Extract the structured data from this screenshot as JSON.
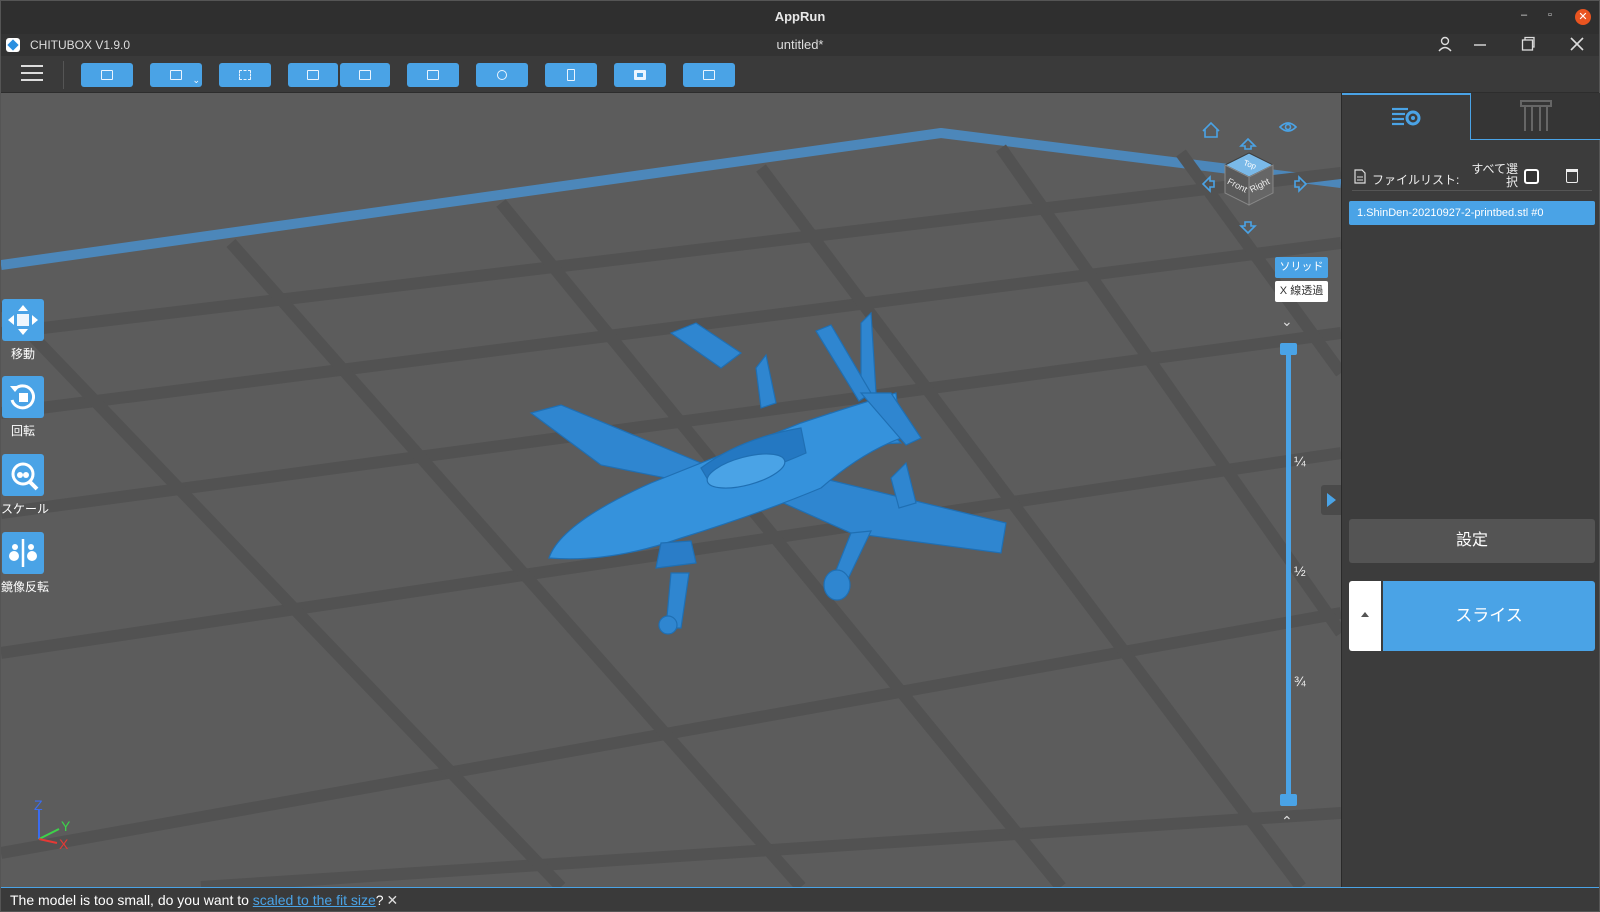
{
  "os_titlebar": {
    "title": "AppRun",
    "minimize": "–",
    "restore": "▫",
    "close": "✕"
  },
  "app_titlebar": {
    "app_name": "CHITUBOX V1.9.0",
    "document": "untitled*"
  },
  "toolbar": {
    "buttons": [
      "open-file",
      "save",
      "select-region",
      "undo",
      "redo",
      "copy",
      "arrange",
      "support",
      "hollow",
      "add-box"
    ]
  },
  "left_tools": [
    {
      "label": "移動",
      "icon": "move-icon"
    },
    {
      "label": "回転",
      "icon": "rotate-icon"
    },
    {
      "label": "スケール",
      "icon": "scale-icon"
    },
    {
      "label": "鏡像反転",
      "icon": "mirror-icon"
    }
  ],
  "view_cube": {
    "top": "Top",
    "front": "Front",
    "right": "Right"
  },
  "view_modes": {
    "solid": "ソリッド",
    "xray": "X 線透過"
  },
  "layer_slider": {
    "marks": [
      "¼",
      "½",
      "¾"
    ],
    "up": "⌃",
    "down": "⌄"
  },
  "axis_gizmo": {
    "z": "Z",
    "y": "Y",
    "x": "X",
    "z_color": "#3b6cf0",
    "y_color": "#3dd34a",
    "x_color": "#e53935"
  },
  "right_panel": {
    "file_list_label": "ファイルリスト:",
    "select_all_label": "すべて選択",
    "files": [
      "1.ShinDen-20210927-2-printbed.stl #0"
    ],
    "settings_label": "設定",
    "slice_label": "スライス"
  },
  "notification": {
    "prefix": "The model is too small, do you want to ",
    "link": "scaled to the fit size",
    "suffix": "?",
    "close": "✕"
  },
  "colors": {
    "accent": "#4aa3e6",
    "grid_bg": "#5c5c5c",
    "panel": "#3c3c3c"
  }
}
